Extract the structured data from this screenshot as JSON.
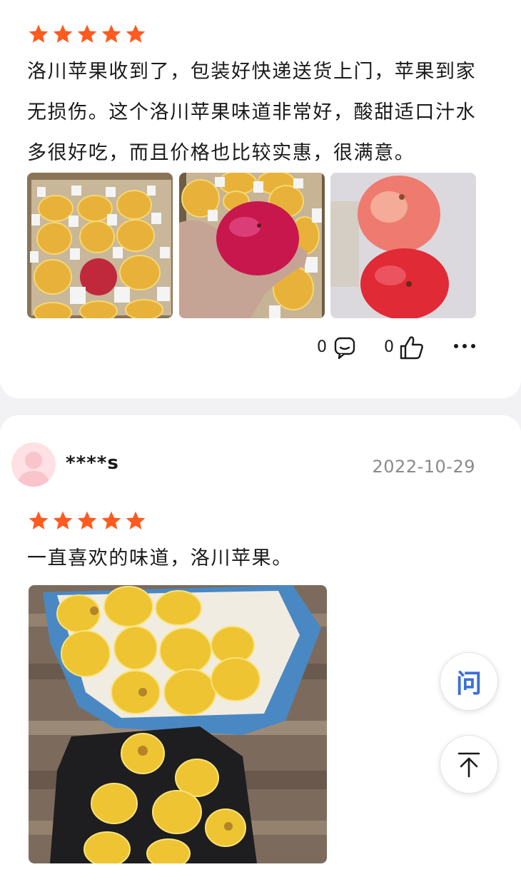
{
  "colors": {
    "star": "#ff5a1f",
    "accent": "#3a6fd8"
  },
  "review1": {
    "rating": 5,
    "text": "洛川苹果收到了，包装好快递送货上门，苹果到家无损伤。这个洛川苹果味道非常好，酸甜适口汁水多很好吃，而且价格也比较实惠，很满意。",
    "comment_count": "0",
    "like_count": "0"
  },
  "review2": {
    "username": "****s",
    "date": "2022-10-29",
    "rating": 5,
    "text": "一直喜欢的味道，洛川苹果。"
  },
  "floating": {
    "ask_label": "问",
    "ask_icon": "question-icon",
    "top_icon": "back-to-top-icon"
  }
}
